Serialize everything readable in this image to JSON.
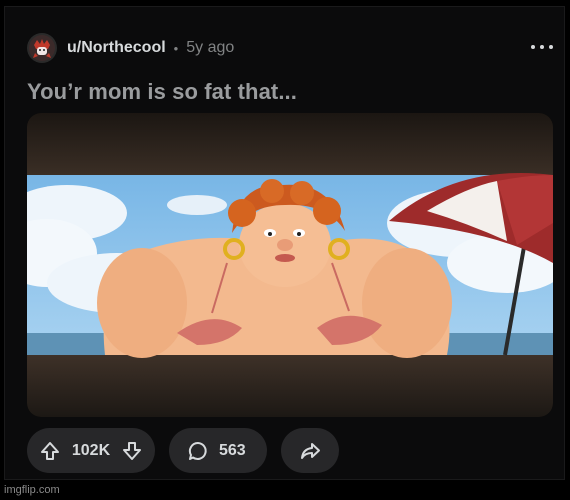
{
  "post": {
    "username": "u/Northecool",
    "separator": "•",
    "age": "5y ago",
    "title": "You’r mom is so fat that..."
  },
  "actions": {
    "score": "102K",
    "comments": "563"
  },
  "watermark": "imgflip.com",
  "icons": {
    "avatar": "avatar-icon",
    "more": "more-options-icon",
    "upvote": "upvote-arrow-icon",
    "downvote": "downvote-arrow-icon",
    "comment": "comment-bubble-icon",
    "share": "share-arrow-icon"
  },
  "colors": {
    "background": "#0b0b0c",
    "pill": "#272729",
    "text": "#d7dadc",
    "muted": "#818384"
  }
}
